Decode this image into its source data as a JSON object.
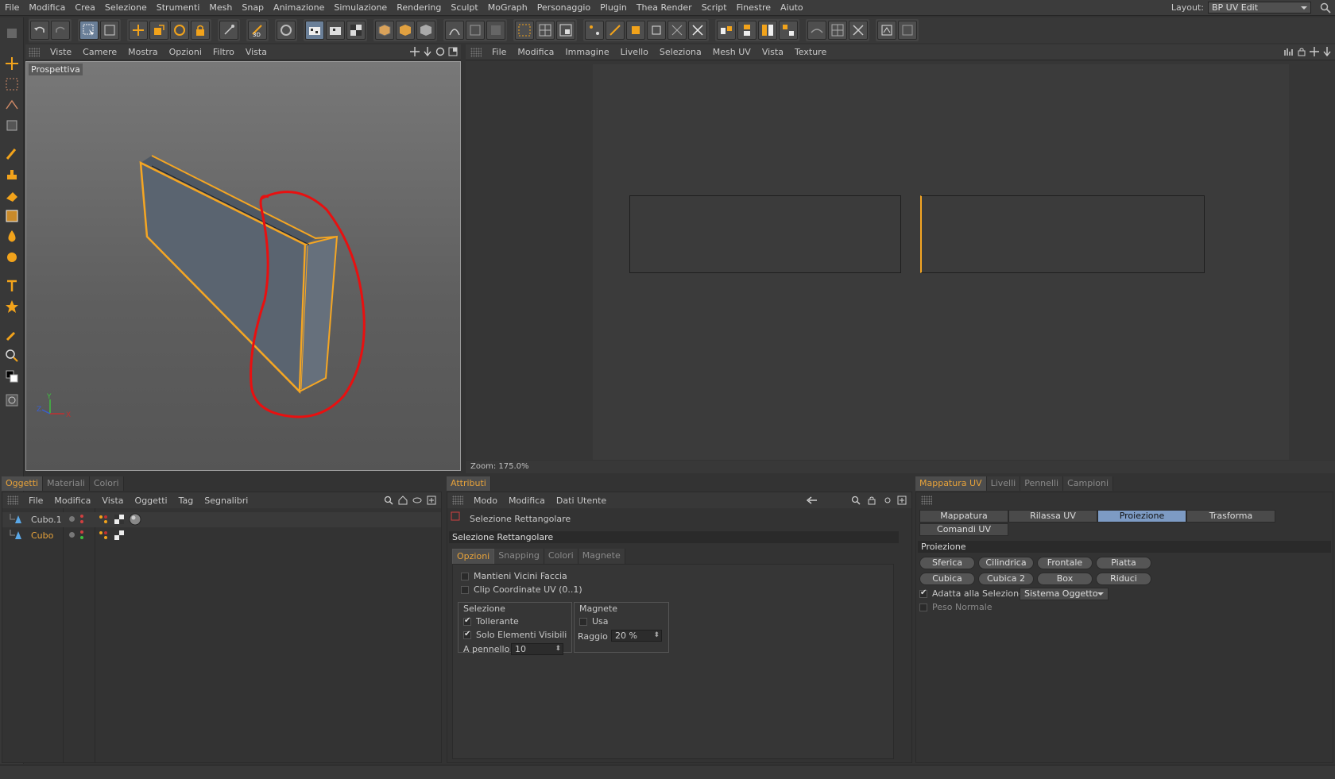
{
  "menubar": {
    "items": [
      "File",
      "Modifica",
      "Crea",
      "Selezione",
      "Strumenti",
      "Mesh",
      "Snap",
      "Animazione",
      "Simulazione",
      "Rendering",
      "Sculpt",
      "MoGraph",
      "Personaggio",
      "Plugin",
      "Thea Render",
      "Script",
      "Finestre",
      "Aiuto"
    ],
    "layout_label": "Layout:",
    "layout_value": "BP UV Edit"
  },
  "viewport": {
    "menu": [
      "Viste",
      "Camere",
      "Mostra",
      "Opzioni",
      "Filtro",
      "Vista"
    ],
    "label": "Prospettiva",
    "axis_y": "Y",
    "axis_z": "Z",
    "axis_x": "X",
    "colors": {
      "selection": "#f5a623",
      "annotation": "#e81010",
      "mesh": "#5a6470"
    }
  },
  "uv_editor": {
    "menu": [
      "File",
      "Modifica",
      "Immagine",
      "Livello",
      "Seleziona",
      "Mesh UV",
      "Vista",
      "Texture"
    ],
    "zoom": "Zoom: 175.0%"
  },
  "objects_panel": {
    "tabs": [
      "Oggetti",
      "Materiali",
      "Colori"
    ],
    "menu": [
      "File",
      "Modifica",
      "Vista",
      "Oggetti",
      "Tag",
      "Segnalibri"
    ],
    "rows": [
      {
        "name": "Cubo.1",
        "selected": false
      },
      {
        "name": "Cubo",
        "selected": true
      }
    ]
  },
  "attributes_panel": {
    "tab": "Attributi",
    "menu": [
      "Modo",
      "Modifica",
      "Dati Utente"
    ],
    "tool_name": "Selezione Rettangolare",
    "section_title": "Selezione Rettangolare",
    "subtabs": [
      "Opzioni",
      "Snapping",
      "Colori",
      "Magnete"
    ],
    "mantieni": "Mantieni Vicini Faccia",
    "clip": "Clip Coordinate UV (0..1)",
    "selezione_group": "Selezione",
    "tollerante": "Tollerante",
    "solo_visibili": "Solo Elementi Visibili",
    "a_pennello_label": "A pennello",
    "a_pennello_value": "10",
    "magnete_group": "Magnete",
    "usa": "Usa",
    "raggio_label": "Raggio",
    "raggio_value": "20 %"
  },
  "uv_panel": {
    "tabs": [
      "Mappatura UV",
      "Livelli",
      "Pennelli",
      "Campioni"
    ],
    "buttons": [
      "Mappatura Ottimale",
      "Rilassa UV",
      "Proiezione",
      "Trasforma",
      "Comandi UV"
    ],
    "section": "Proiezione",
    "proj_row1": [
      "Sferica",
      "Cilindrica",
      "Frontale",
      "Piatta"
    ],
    "proj_row2": [
      "Cubica",
      "Cubica 2",
      "Box",
      "Riduci"
    ],
    "adatta": "Adatta alla Selezione",
    "sistema": "Sistema Oggetto",
    "peso": "Peso Normale"
  }
}
